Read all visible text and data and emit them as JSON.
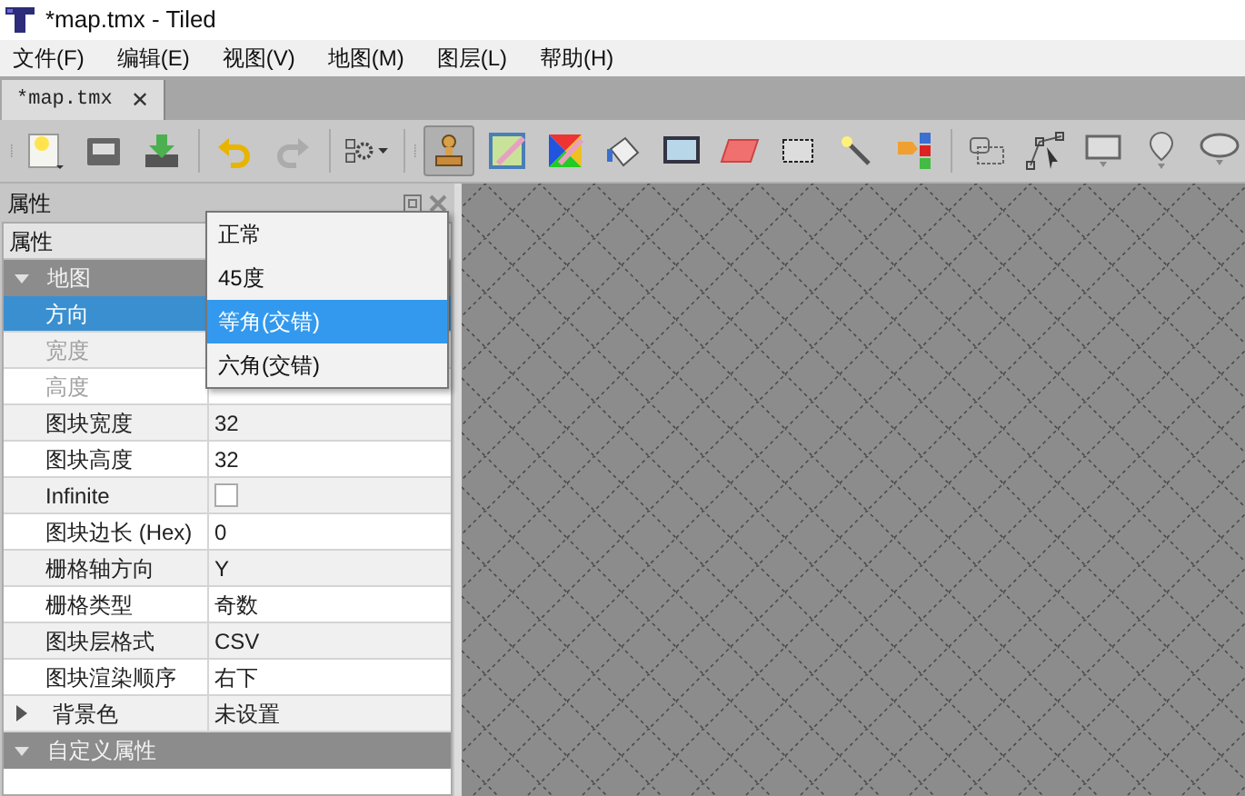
{
  "window": {
    "title": "*map.tmx - Tiled"
  },
  "menu": [
    "文件(F)",
    "编辑(E)",
    "视图(V)",
    "地图(M)",
    "图层(L)",
    "帮助(H)"
  ],
  "tabs": [
    {
      "label": "*map.tmx",
      "selected": true,
      "close": "✕"
    }
  ],
  "toolbar": [
    {
      "kind": "new",
      "selected": false,
      "disabled": false
    },
    {
      "kind": "open",
      "selected": false,
      "disabled": false
    },
    {
      "kind": "save",
      "selected": false,
      "disabled": false
    },
    {
      "kind": "sep"
    },
    {
      "kind": "undo",
      "selected": false,
      "disabled": false
    },
    {
      "kind": "redo",
      "selected": false,
      "disabled": true
    },
    {
      "kind": "sep"
    },
    {
      "kind": "commands",
      "selected": false,
      "disabled": false
    },
    {
      "kind": "sep"
    },
    {
      "kind": "stamp",
      "selected": true,
      "disabled": false
    },
    {
      "kind": "terrain",
      "selected": false,
      "disabled": false
    },
    {
      "kind": "wang",
      "selected": false,
      "disabled": false
    },
    {
      "kind": "bucket",
      "selected": false,
      "disabled": false
    },
    {
      "kind": "shape",
      "selected": false,
      "disabled": false
    },
    {
      "kind": "eraser",
      "selected": false,
      "disabled": false
    },
    {
      "kind": "rectselect",
      "selected": false,
      "disabled": false
    },
    {
      "kind": "wand",
      "selected": false,
      "disabled": false
    },
    {
      "kind": "sametile",
      "selected": false,
      "disabled": false
    },
    {
      "kind": "sep"
    },
    {
      "kind": "selectobj",
      "selected": false,
      "disabled": false
    },
    {
      "kind": "editpoly",
      "selected": false,
      "disabled": false
    },
    {
      "kind": "rect",
      "selected": false,
      "disabled": false
    },
    {
      "kind": "point",
      "selected": false,
      "disabled": false
    },
    {
      "kind": "ellipse",
      "selected": false,
      "disabled": false
    }
  ],
  "panel": {
    "title": "属性",
    "column_header": "属性",
    "rows": [
      {
        "kind": "group",
        "name": "地图",
        "expanded": true
      },
      {
        "kind": "prop",
        "name": "方向",
        "selected": true,
        "disabled": false
      },
      {
        "kind": "prop",
        "name": "宽度",
        "selected": false,
        "disabled": true
      },
      {
        "kind": "prop",
        "name": "高度",
        "selected": false,
        "disabled": true
      },
      {
        "kind": "prop",
        "name": "图块宽度",
        "value": "32",
        "selected": false,
        "disabled": false
      },
      {
        "kind": "prop",
        "name": "图块高度",
        "value": "32",
        "selected": false,
        "disabled": false
      },
      {
        "kind": "check",
        "name": "Infinite",
        "checked": false,
        "selected": false,
        "disabled": false
      },
      {
        "kind": "prop",
        "name": "图块边长 (Hex)",
        "value": "0",
        "selected": false,
        "disabled": false
      },
      {
        "kind": "prop",
        "name": "栅格轴方向",
        "value": "Y",
        "selected": false,
        "disabled": false
      },
      {
        "kind": "prop",
        "name": "栅格类型",
        "value": "奇数",
        "selected": false,
        "disabled": false
      },
      {
        "kind": "prop",
        "name": "图块层格式",
        "value": "CSV",
        "selected": false,
        "disabled": false
      },
      {
        "kind": "prop",
        "name": "图块渲染顺序",
        "value": "右下",
        "selected": false,
        "disabled": false
      },
      {
        "kind": "expander",
        "name": "背景色",
        "value": "未设置",
        "expanded": false
      },
      {
        "kind": "group",
        "name": "自定义属性",
        "expanded": true
      }
    ]
  },
  "dropdown": [
    {
      "label": "正常",
      "selected": false
    },
    {
      "label": "45度",
      "selected": false
    },
    {
      "label": "等角(交错)",
      "selected": true
    },
    {
      "label": "六角(交错)",
      "selected": false
    }
  ]
}
